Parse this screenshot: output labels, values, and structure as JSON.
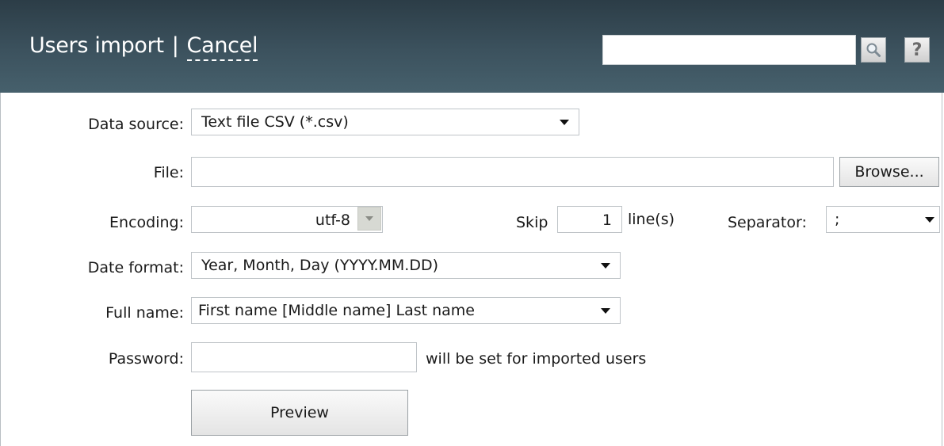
{
  "header": {
    "title": "Users import",
    "separator": "|",
    "cancel_label": "Cancel",
    "search_placeholder": "",
    "search_icon": "magnifier-icon",
    "help_label": "?"
  },
  "form": {
    "data_source": {
      "label": "Data source:",
      "value": "Text file CSV (*.csv)"
    },
    "file": {
      "label": "File:",
      "value": "",
      "browse_label": "Browse..."
    },
    "encoding": {
      "label": "Encoding:",
      "value": "utf-8"
    },
    "skip": {
      "label": "Skip",
      "value": "1",
      "suffix": "line(s)"
    },
    "separator": {
      "label": "Separator:",
      "value": ";"
    },
    "date_format": {
      "label": "Date format:",
      "value": "Year, Month, Day (YYYY.MM.DD)"
    },
    "full_name": {
      "label": "Full name:",
      "value": "First name [Middle name] Last name"
    },
    "password": {
      "label": "Password:",
      "value": "",
      "hint": "will be set for imported users"
    },
    "preview_label": "Preview"
  },
  "colors": {
    "header_top": "#2c3d47",
    "header_bottom": "#46606c",
    "field_border": "#bfc4c8",
    "encoding_arrow_bg": "#d7d9d3"
  }
}
